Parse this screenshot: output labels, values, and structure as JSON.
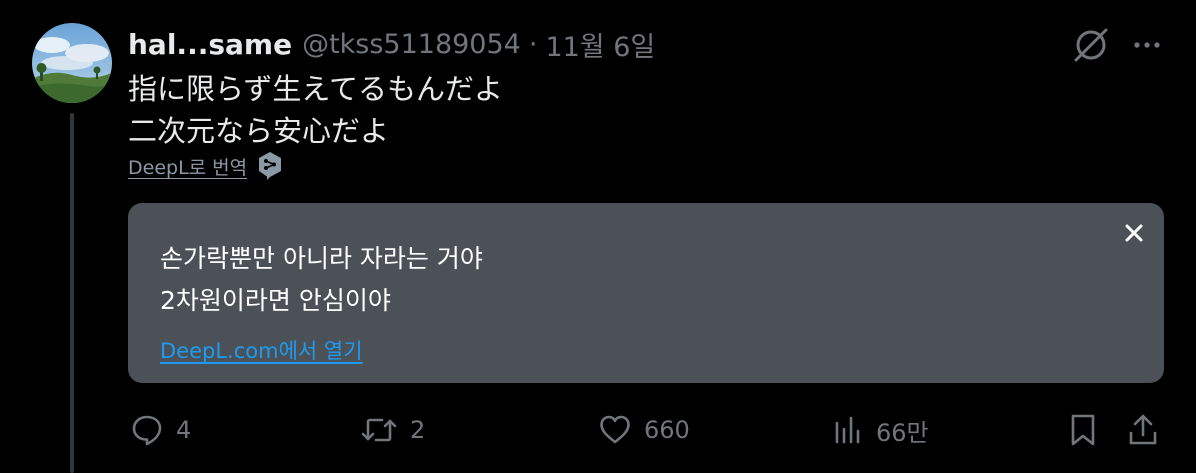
{
  "tweet": {
    "display_name": "hal...same",
    "handle": "@tkss51189054",
    "separator": "·",
    "date": "11월 6일",
    "text_lines": [
      "指に限らず生えてるもんだよ",
      "二次元なら安心だよ"
    ]
  },
  "translate": {
    "link_label": "DeepL로 번역"
  },
  "translation": {
    "lines": [
      "손가락뿐만 아니라 자라는 거야",
      "2차원이라면 안심이야"
    ],
    "open_link": "DeepL.com에서 열기"
  },
  "actions": {
    "reply_count": "4",
    "retweet_count": "2",
    "like_count": "660",
    "views_count": "66만"
  },
  "icons": {
    "top": [
      "no-grok-icon",
      "more-icon"
    ],
    "actions": [
      "reply-icon",
      "retweet-icon",
      "like-icon",
      "views-icon",
      "bookmark-icon",
      "share-icon"
    ]
  },
  "colors": {
    "background": "#000000",
    "primary_text": "#e7e9ea",
    "secondary_text": "#71767b",
    "translation_box": "#4b5157",
    "link": "#1d9bf0"
  }
}
